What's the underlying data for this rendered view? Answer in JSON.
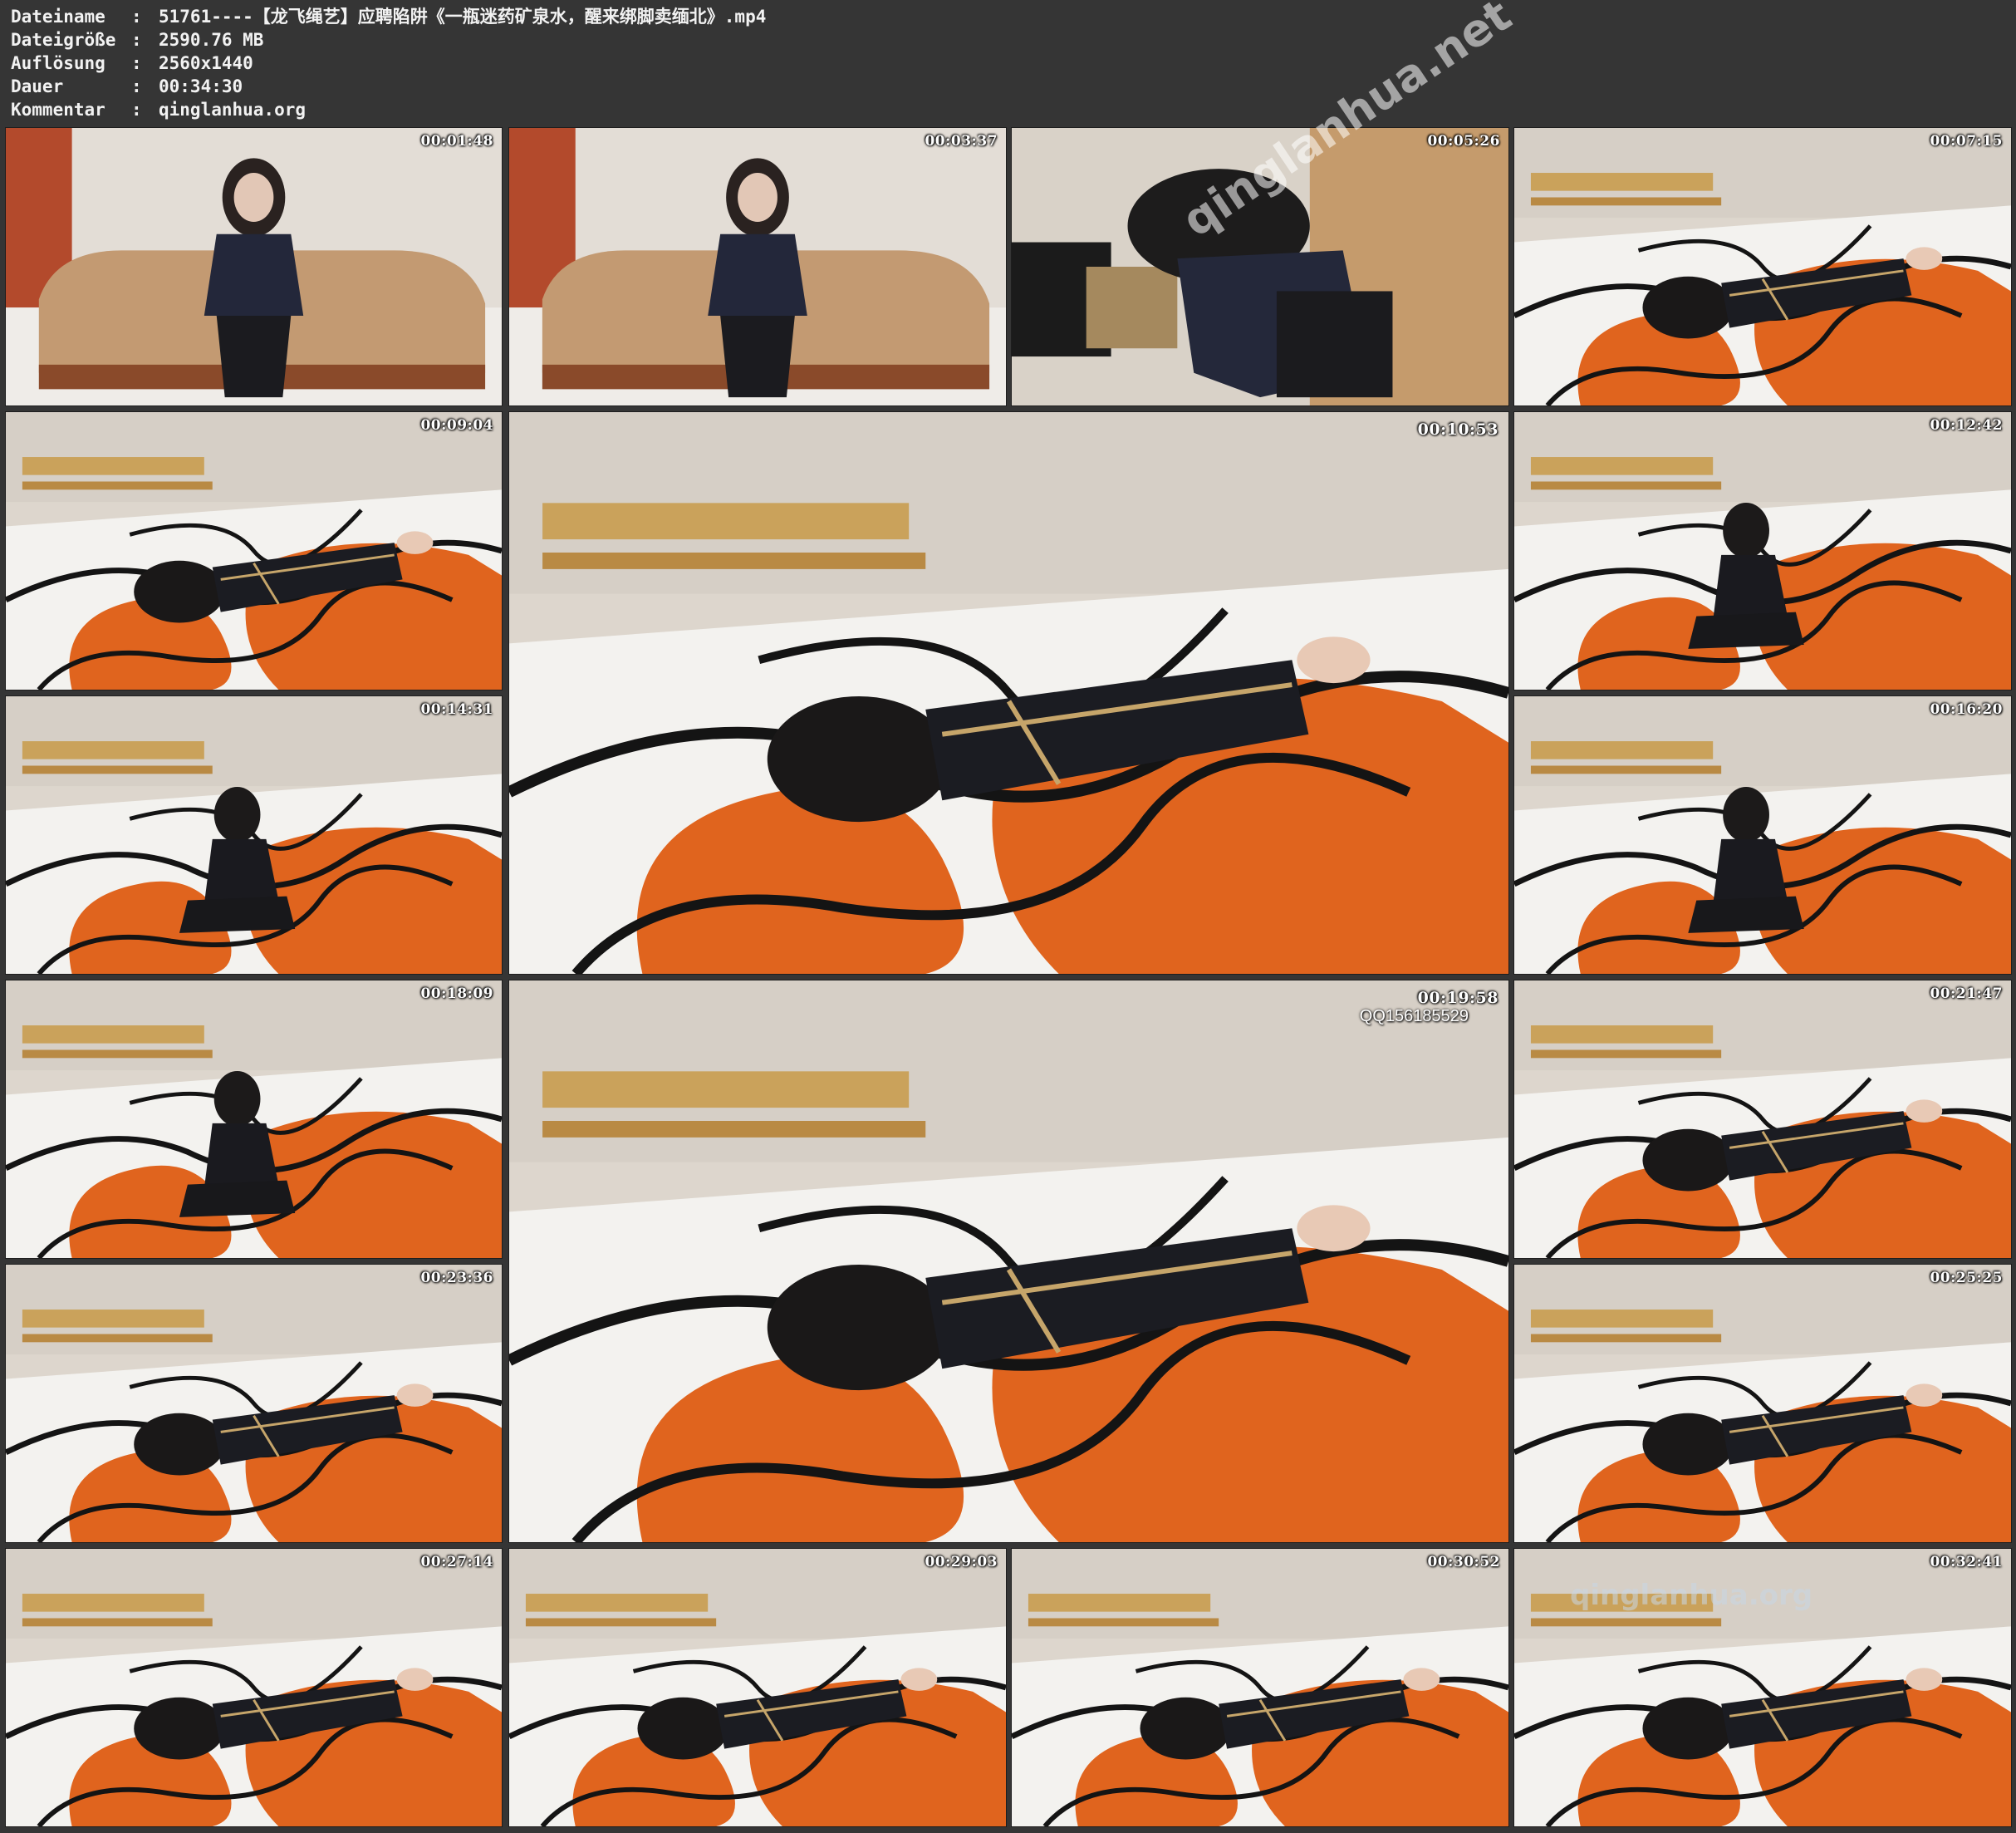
{
  "file_info": {
    "rows": [
      {
        "key": "Dateiname",
        "sep": ":",
        "value": "51761----【龙飞绳艺】应聘陷阱《一瓶迷药矿泉水，醒来绑脚卖缅北》.mp4"
      },
      {
        "key": "Dateigröße",
        "sep": ":",
        "value": "2590.76 MB"
      },
      {
        "key": "Auflösung",
        "sep": ":",
        "value": "2560x1440"
      },
      {
        "key": "Dauer",
        "sep": ":",
        "value": "00:34:30"
      },
      {
        "key": "Kommentar",
        "sep": ":",
        "value": "qinglanhua.org"
      }
    ]
  },
  "thumbnails": [
    {
      "time": "00:01:48",
      "scene": "sofa"
    },
    {
      "time": "00:03:37",
      "scene": "sofa"
    },
    {
      "time": "00:05:26",
      "scene": "bend"
    },
    {
      "time": "00:07:15",
      "scene": "rug-lying"
    },
    {
      "time": "00:09:04",
      "scene": "rug-lying"
    },
    {
      "time": "00:10:53",
      "scene": "rug-large"
    },
    {
      "time": "00:12:42",
      "scene": "rug-sitting"
    },
    {
      "time": "00:14:31",
      "scene": "rug-sitting"
    },
    {
      "time": "00:16:20",
      "scene": "rug-sitting"
    },
    {
      "time": "00:18:09",
      "scene": "rug-sitting"
    },
    {
      "time": "00:19:58",
      "scene": "rug-large",
      "overlay": "QQ156185529"
    },
    {
      "time": "00:21:47",
      "scene": "rug-lying"
    },
    {
      "time": "00:23:36",
      "scene": "rug-lying"
    },
    {
      "time": "00:25:25",
      "scene": "rug-lying"
    },
    {
      "time": "00:27:14",
      "scene": "rug-lying"
    },
    {
      "time": "00:29:03",
      "scene": "rug-lying"
    },
    {
      "time": "00:30:52",
      "scene": "rug-lying"
    },
    {
      "time": "00:32:41",
      "scene": "rug-lying"
    }
  ],
  "watermarks": [
    "qinglanhua.net",
    "qinglanhua.org"
  ],
  "colors": {
    "background": "#353535",
    "rug_orange": "#e0641e",
    "rug_white": "#f3f2ef",
    "line_black": "#141414"
  }
}
